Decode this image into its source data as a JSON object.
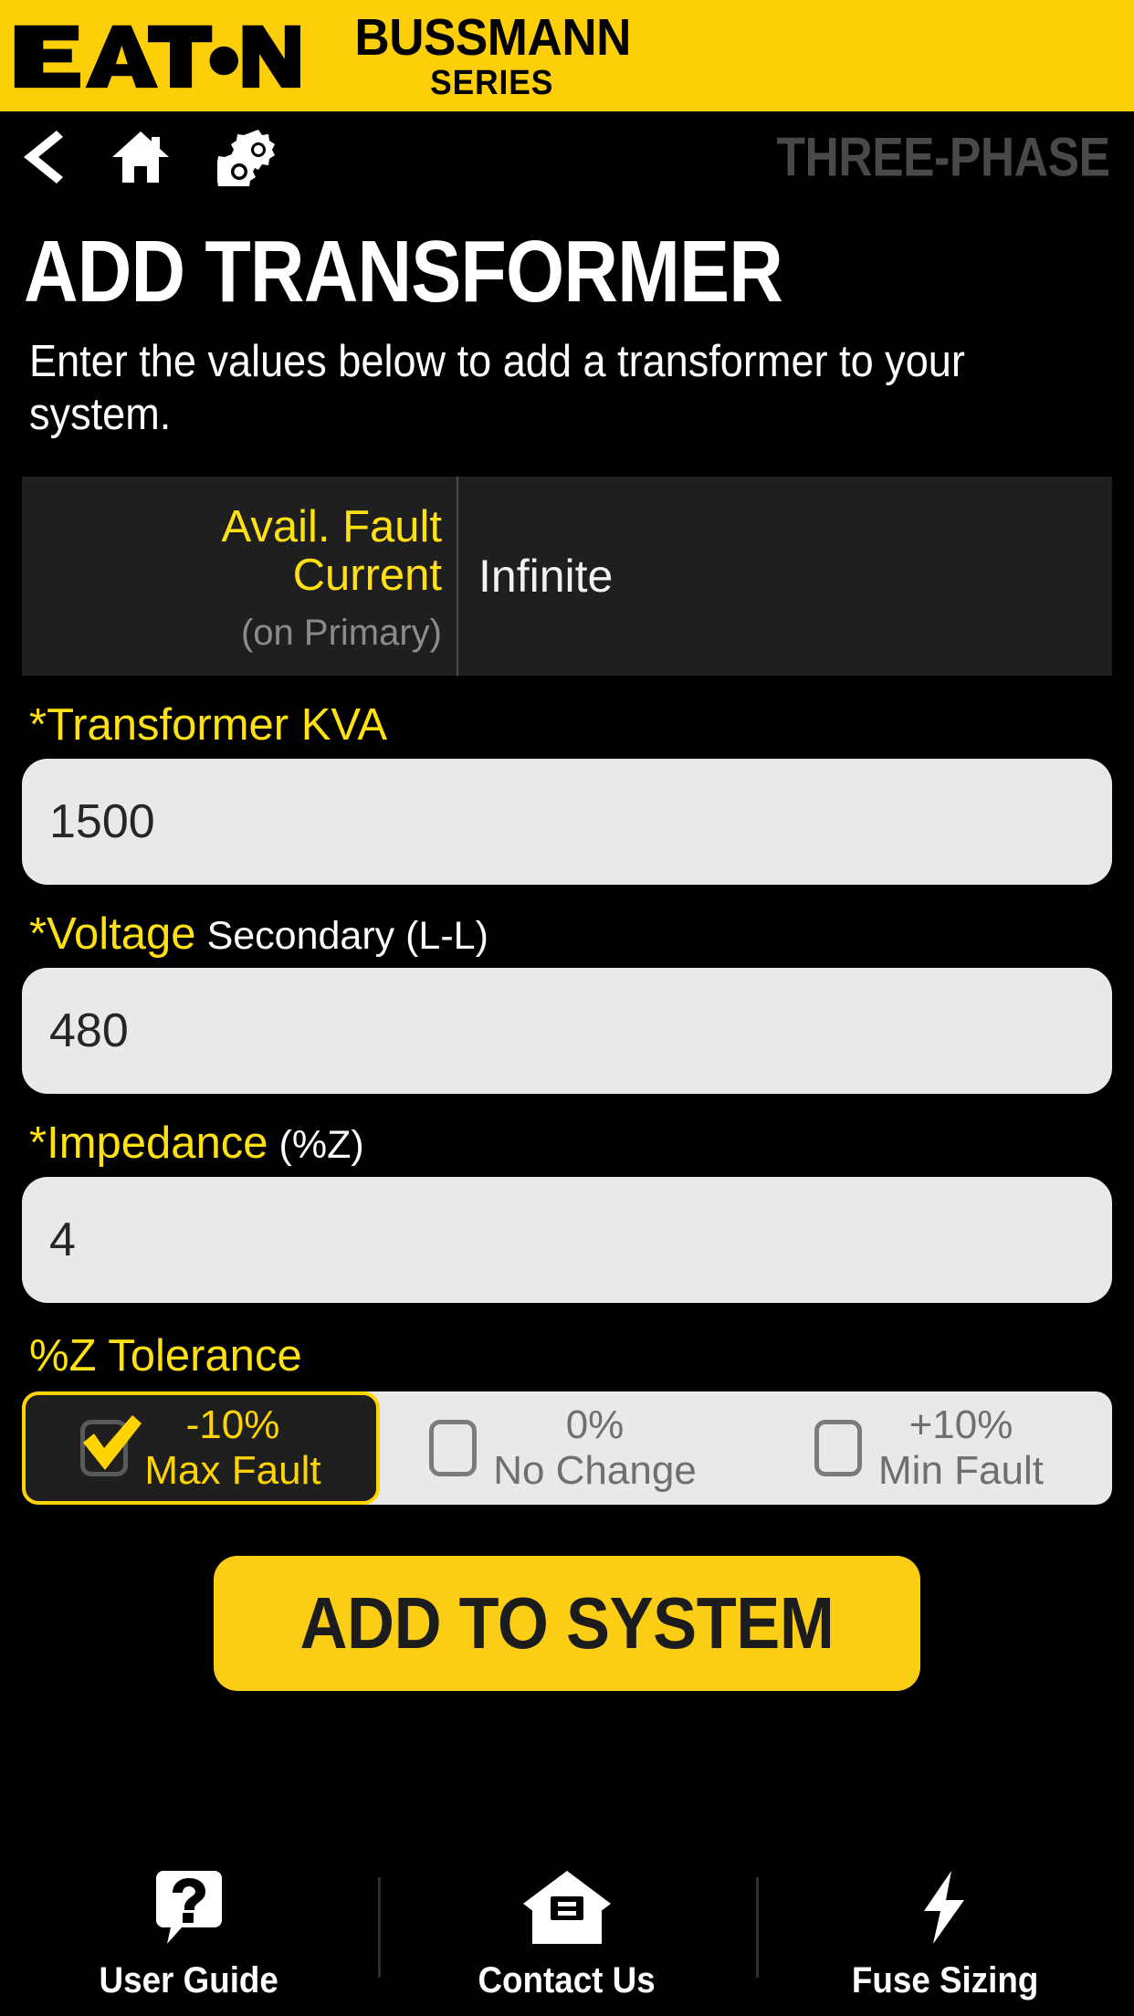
{
  "brand": {
    "logo_name": "eaton-logo",
    "logo_text": "EAT•N",
    "product_line": "BUSSMANN",
    "product_series": "SERIES",
    "bar_color": "#fdcf09"
  },
  "nav": {
    "back_icon": "back-chevron-icon",
    "home_icon": "home-icon",
    "settings_icon": "gears-icon",
    "kicker": "THREE-PHASE",
    "kicker_color": "#494949"
  },
  "page": {
    "title": "ADD TRANSFORMER",
    "description": "Enter the values below to add a transformer to your system."
  },
  "fault_panel": {
    "label_line1": "Avail. Fault",
    "label_line2": "Current",
    "sub_label": "(on Primary)",
    "value": "Infinite",
    "label_color": "#ffe013",
    "panel_color": "#1f1f1f"
  },
  "fields": [
    {
      "name": "transformer-kva",
      "required_mark": "*",
      "label": "Transformer KVA",
      "hint": "",
      "value": "1500",
      "placeholder": ""
    },
    {
      "name": "voltage-secondary",
      "required_mark": "*",
      "label": "Voltage",
      "hint": "Secondary (L-L)",
      "value": "480",
      "placeholder": ""
    },
    {
      "name": "impedance",
      "required_mark": "*",
      "label": "Impedance",
      "hint": "(%Z)",
      "value": "4",
      "placeholder": ""
    }
  ],
  "tolerance": {
    "label": "%Z Tolerance",
    "options": [
      {
        "value": "-10%",
        "caption": "Max Fault",
        "selected": true
      },
      {
        "value": "0%",
        "caption": "No Change",
        "selected": false
      },
      {
        "value": "+10%",
        "caption": "Min Fault",
        "selected": false
      }
    ],
    "selected_color": "#ffd400",
    "unselected_color": "#6f6f6f",
    "track_color": "#e9e9e9"
  },
  "primary_action": {
    "label": "ADD TO SYSTEM",
    "color": "#fbcd14",
    "text_color": "#1c1c1c"
  },
  "bottom_nav": [
    {
      "label": "User Guide",
      "icon": "question-bubble-icon"
    },
    {
      "label": "Contact Us",
      "icon": "envelope-icon"
    },
    {
      "label": "Fuse Sizing",
      "icon": "lightning-bolt-icon"
    }
  ]
}
